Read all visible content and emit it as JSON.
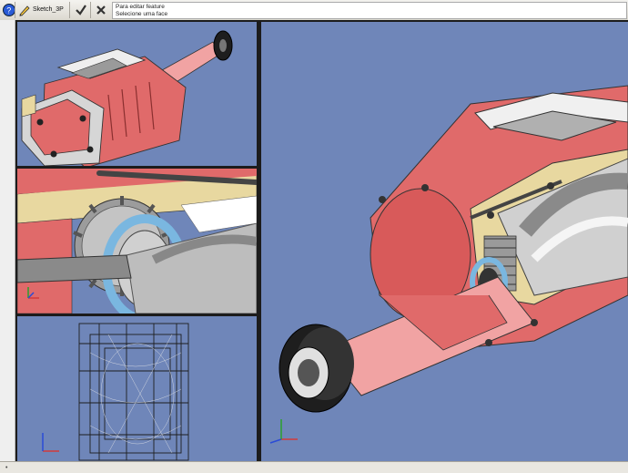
{
  "toolbar": {
    "sketch_label": "Sketch_3P",
    "message_line1": "Para editar feature",
    "message_line2": "Selecione uma face"
  },
  "viewports": [
    "top-left",
    "middle-left",
    "bottom-left",
    "main"
  ],
  "colors": {
    "viewport_bg": "#6f86b9",
    "part_red": "#e06a6a",
    "part_pink": "#f1a3a3",
    "cut_face": "#e8d8a0",
    "metal_gray": "#b8b8b8",
    "axis_x": "#d23a3a",
    "axis_y": "#2ca02c",
    "axis_z": "#2a4bd6"
  },
  "icons": [
    "help-icon",
    "sketch-icon",
    "check-icon",
    "cancel-icon"
  ]
}
